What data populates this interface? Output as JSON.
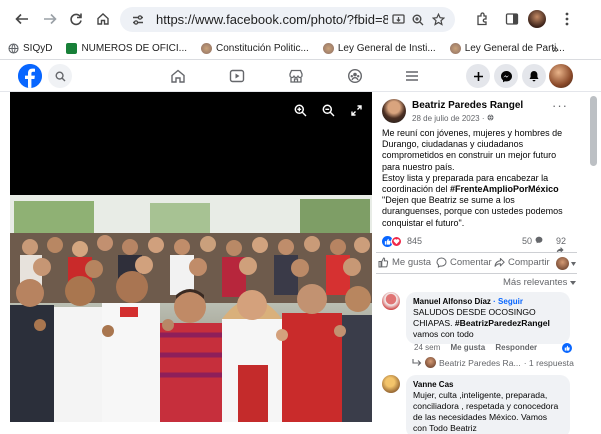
{
  "browser": {
    "url": "https://www.facebook.com/photo/?fbid=8205068...",
    "bookmarks": [
      {
        "label": "SIQyD",
        "icon": "globe-icon",
        "color": "#5f6368"
      },
      {
        "label": "NUMEROS DE OFICI...",
        "icon": "sheets-icon",
        "color": "#188038"
      },
      {
        "label": "Constitución Politic...",
        "icon": "seal-icon",
        "color": "#8d6e63"
      },
      {
        "label": "Ley General de Insti...",
        "icon": "seal-icon",
        "color": "#8d6e63"
      },
      {
        "label": "Ley General de Parti...",
        "icon": "seal-icon",
        "color": "#8d6e63"
      }
    ],
    "overflow_label": "»"
  },
  "colors": {
    "facebook_blue": "#0866ff",
    "love_red": "#f02849",
    "muted_text": "#65676b",
    "bubble_bg": "#f0f2f5"
  },
  "post": {
    "author": "Beatriz Paredes Rangel",
    "date": "28 de julio de 2023 · ",
    "text_1": "Me reuní con jóvenes, mujeres y hombres de Durango, ciudadanas y ciudadanos comprometidos en construir un mejor futuro para nuestro país.",
    "text_2_before": "Estoy lista y preparada para encabezar la coordinación del ",
    "hashtag": "#FrenteAmplioPorMéxico",
    "text_3": "\"Dejen que Beatriz se sume a los duranguenses, porque con ustedes podemos conquistar el futuro\".",
    "reaction_count": "845",
    "comment_count": "50",
    "share_count": "92"
  },
  "actions": {
    "like": "Me gusta",
    "comment": "Comentar",
    "share": "Compartir"
  },
  "sort_label": "Más relevantes",
  "comments": [
    {
      "name": "Manuel Alfonso Díaz",
      "follow": " · Seguir",
      "text_before": "SALUDOS DESDE OCOSINGO CHIAPAS. ",
      "hashtag": "#BeatrizParedezRangel",
      "text_after": " vamos con todo",
      "time": "24 sem",
      "like": "Me gusta",
      "reply": "Responder",
      "reply_author": "Beatriz Paredes Ra...",
      "reply_count": " · 1 respuesta"
    },
    {
      "name": "Vanne Cas",
      "text": "Mujer, culta ,inteligente, preparada, conciliadora , respetada y conocedora de las necesidades México. Vamos con Todo Beatriz"
    }
  ]
}
